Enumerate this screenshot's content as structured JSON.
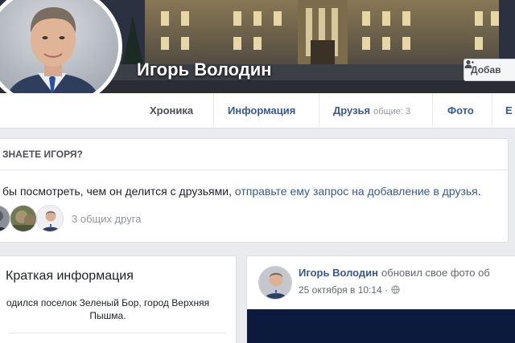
{
  "profile": {
    "name": "Игорь Володин",
    "add_friend_label": "Добав"
  },
  "tabs": [
    {
      "label": "Хроника",
      "sub": "",
      "active": true
    },
    {
      "label": "Информация",
      "sub": ""
    },
    {
      "label": "Друзья",
      "sub": "общие: 3"
    },
    {
      "label": "Фото",
      "sub": ""
    },
    {
      "label": "Е",
      "sub": ""
    }
  ],
  "know": {
    "title": "ЗНАЕТЕ ИГОРЯ?",
    "text_prefix": "бы посмотреть, чем он делится с друзьями,",
    "text_link": "отправьте ему запрос на добавление в друзья",
    "text_suffix": ".",
    "mutual_label": "3 общих друга"
  },
  "intro": {
    "title": "Краткая информация",
    "line": "одился поселок Зеленый Бор, город Верхняя Пышма."
  },
  "post": {
    "author": "Игорь Володин",
    "action": "обновил свое фото об",
    "date": "25 октября в 10:14 ·"
  },
  "colors": {
    "link": "#365899",
    "background": "#e9ebee"
  },
  "icons": {
    "add_friend": "add-friend-icon",
    "privacy": "globe-icon"
  }
}
